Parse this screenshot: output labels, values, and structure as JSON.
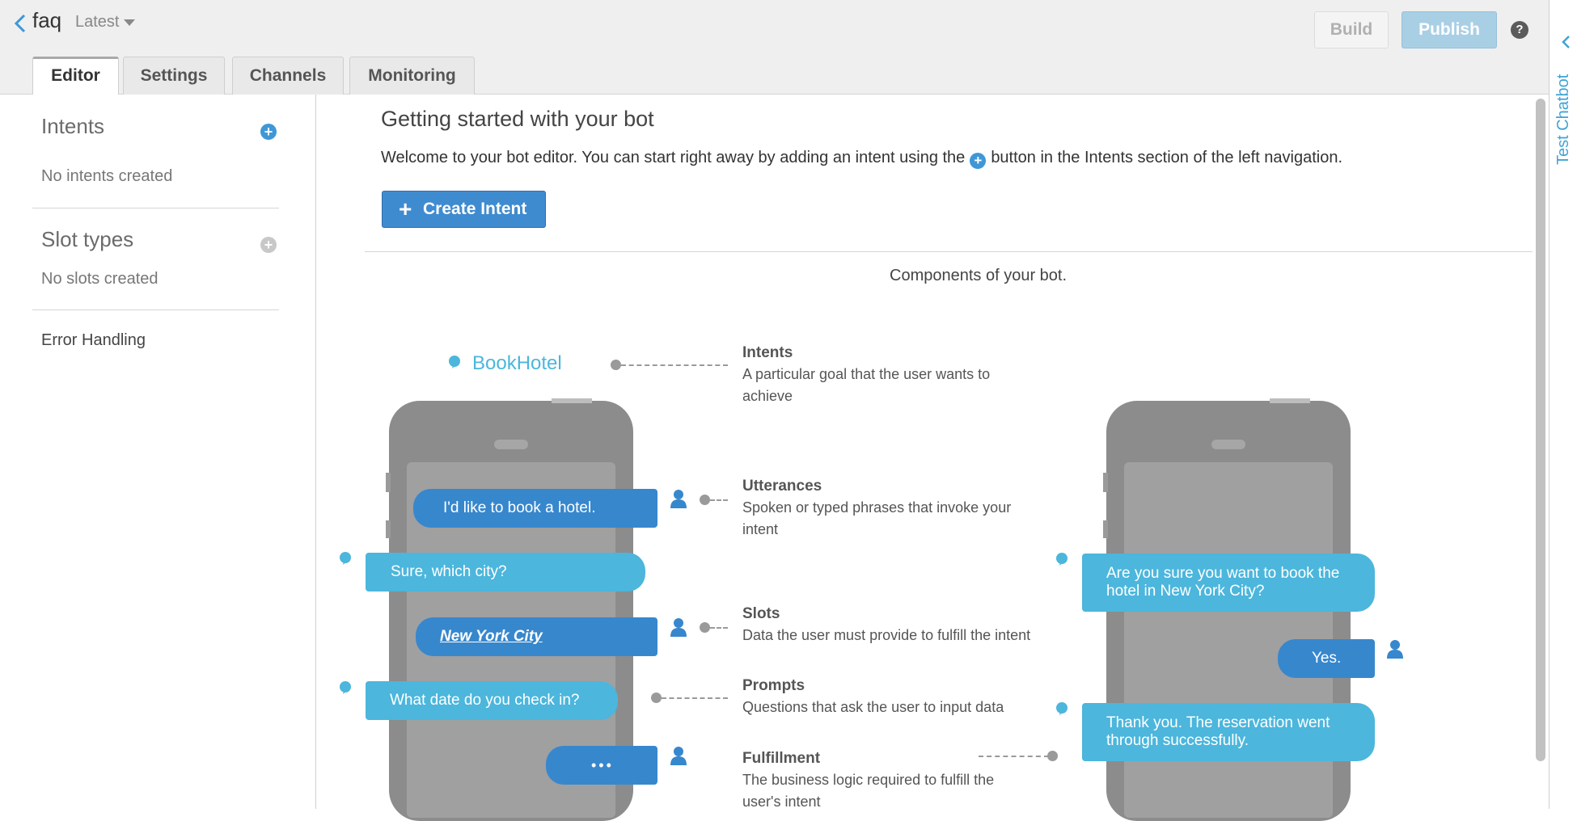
{
  "header": {
    "bot_name": "faq",
    "version": "Latest",
    "build_label": "Build",
    "publish_label": "Publish",
    "help_label": "?"
  },
  "tabs": [
    {
      "label": "Editor",
      "active": true
    },
    {
      "label": "Settings",
      "active": false
    },
    {
      "label": "Channels",
      "active": false
    },
    {
      "label": "Monitoring",
      "active": false
    }
  ],
  "sidebar": {
    "intents_heading": "Intents",
    "intents_empty": "No intents created",
    "slot_types_heading": "Slot types",
    "slots_empty": "No slots created",
    "error_handling": "Error Handling"
  },
  "right_rail": {
    "label": "Test Chatbot"
  },
  "main": {
    "title": "Getting started with your bot",
    "welcome_before": "Welcome to your bot editor. You can start right away by adding an intent using the",
    "welcome_after": "button in the Intents section of the left navigation.",
    "create_intent_label": "Create Intent",
    "components_title": "Components of your bot."
  },
  "diagram": {
    "intent_name": "BookHotel",
    "left_chat": {
      "utterance": "I'd like to book a hotel.",
      "prompt_city": "Sure, which city?",
      "slot_value": "New York City",
      "prompt_date": "What date do you check in?",
      "typing": "•••"
    },
    "right_chat": {
      "confirm": "Are you sure you want to book the hotel in New York City?",
      "yes": "Yes.",
      "done": "Thank you. The reservation went through successfully."
    },
    "labels": [
      {
        "title": "Intents",
        "desc": "A particular goal that the user wants to achieve"
      },
      {
        "title": "Utterances",
        "desc": "Spoken or typed phrases that invoke your intent"
      },
      {
        "title": "Slots",
        "desc": "Data the user must provide to fulfill the intent"
      },
      {
        "title": "Prompts",
        "desc": "Questions that ask the user to input data"
      },
      {
        "title": "Fulfillment",
        "desc": "The business logic required to fulfill the user's intent"
      }
    ]
  },
  "colors": {
    "accent": "#3f8bd0",
    "user_bubble": "#3787cd",
    "bot_bubble": "#4cb6dc",
    "phone": "#8c8c8c"
  }
}
